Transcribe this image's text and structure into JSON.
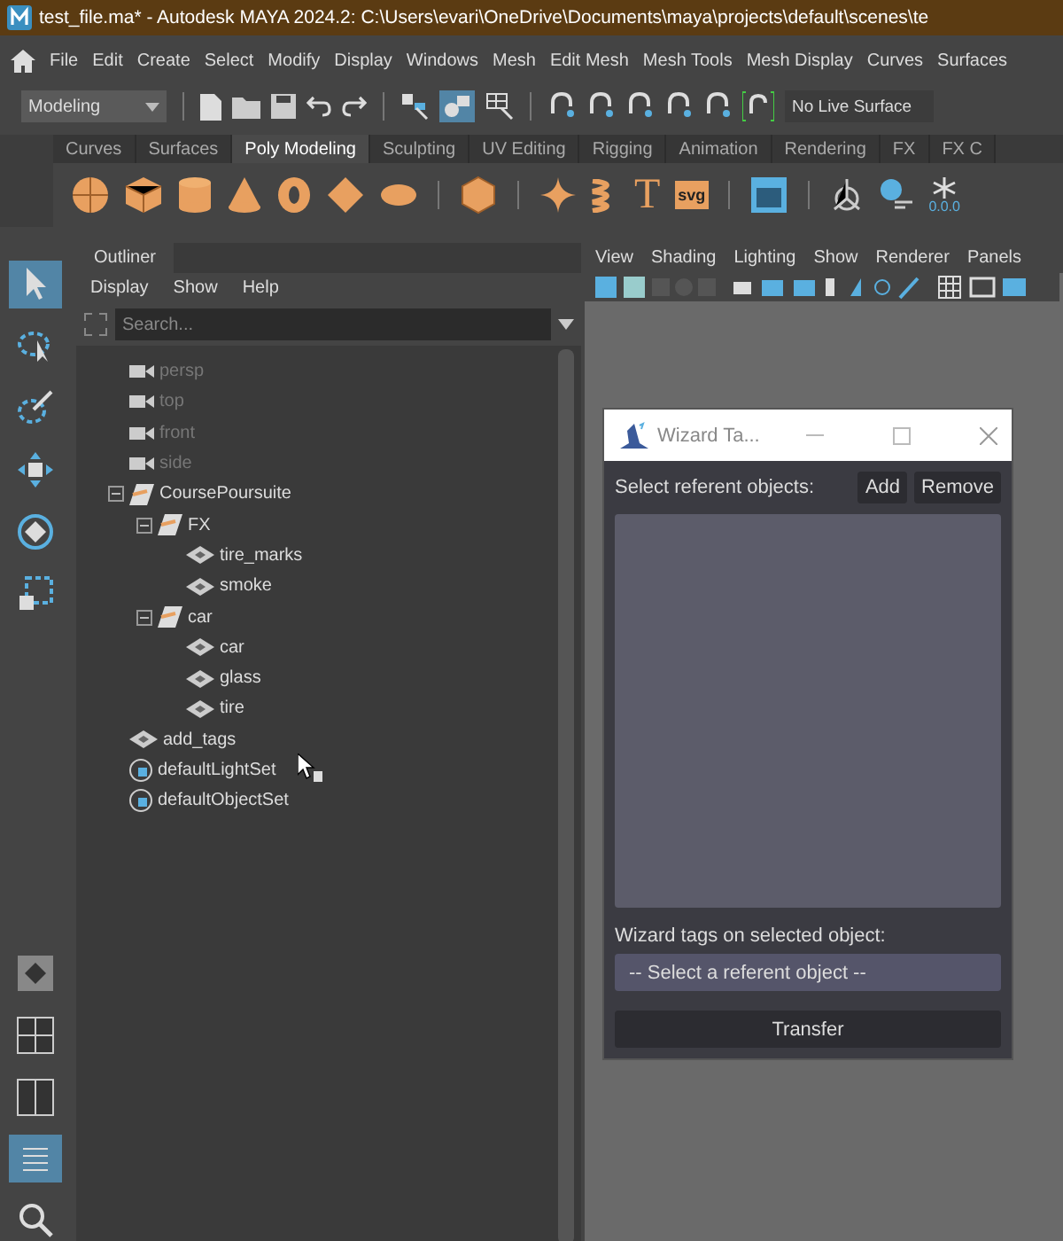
{
  "window": {
    "title": "test_file.ma* - Autodesk MAYA 2024.2: C:\\Users\\evari\\OneDrive\\Documents\\maya\\projects\\default\\scenes\\te"
  },
  "menu_bar": [
    "File",
    "Edit",
    "Create",
    "Select",
    "Modify",
    "Display",
    "Windows",
    "Mesh",
    "Edit Mesh",
    "Mesh Tools",
    "Mesh Display",
    "Curves",
    "Surfaces"
  ],
  "toolbar": {
    "mode": "Modeling",
    "live_surface": "No Live Surface"
  },
  "shelf_tabs": [
    {
      "label": "Curves",
      "selected": false
    },
    {
      "label": "Surfaces",
      "selected": false
    },
    {
      "label": "Poly Modeling",
      "selected": true
    },
    {
      "label": "Sculpting",
      "selected": false
    },
    {
      "label": "UV Editing",
      "selected": false
    },
    {
      "label": "Rigging",
      "selected": false
    },
    {
      "label": "Animation",
      "selected": false
    },
    {
      "label": "Rendering",
      "selected": false
    },
    {
      "label": "FX",
      "selected": false
    },
    {
      "label": "FX C",
      "selected": false
    }
  ],
  "shelf": {
    "type_tool": "T",
    "svg_tool": "svg",
    "snapshot_reading": "0.0.0"
  },
  "outliner": {
    "tab": "Outliner",
    "menu": [
      "Display",
      "Show",
      "Help"
    ],
    "search": {
      "placeholder": "Search..."
    },
    "items": [
      {
        "kind": "camera",
        "label": "persp",
        "hidden": true
      },
      {
        "kind": "camera",
        "label": "top",
        "hidden": true
      },
      {
        "kind": "camera",
        "label": "front",
        "hidden": true
      },
      {
        "kind": "camera",
        "label": "side",
        "hidden": true
      },
      {
        "kind": "group",
        "label": "CoursePoursuite",
        "hidden": false,
        "expanded": true,
        "children": [
          {
            "kind": "group",
            "label": "FX",
            "hidden": false,
            "expanded": true,
            "children": [
              {
                "kind": "mesh",
                "label": "tire_marks",
                "hidden": false
              },
              {
                "kind": "mesh",
                "label": "smoke",
                "hidden": false
              }
            ]
          },
          {
            "kind": "group",
            "label": "car",
            "hidden": false,
            "expanded": true,
            "children": [
              {
                "kind": "mesh",
                "label": "car",
                "hidden": false
              },
              {
                "kind": "mesh",
                "label": "glass",
                "hidden": false
              },
              {
                "kind": "mesh",
                "label": "tire",
                "hidden": false
              }
            ]
          }
        ]
      },
      {
        "kind": "mesh",
        "label": "add_tags",
        "hidden": false
      },
      {
        "kind": "set",
        "label": "defaultLightSet",
        "hidden": false
      },
      {
        "kind": "set",
        "label": "defaultObjectSet",
        "hidden": false
      }
    ]
  },
  "viewport": {
    "menu": [
      "View",
      "Shading",
      "Lighting",
      "Show",
      "Renderer",
      "Panels"
    ]
  },
  "dialog": {
    "title": "Wizard Ta...",
    "referent_label": "Select referent objects:",
    "buttons": [
      "Add",
      "Remove"
    ],
    "tags_label": "Wizard tags on selected object:",
    "tags_select": "-- Select a referent object --",
    "action": "Transfer"
  }
}
